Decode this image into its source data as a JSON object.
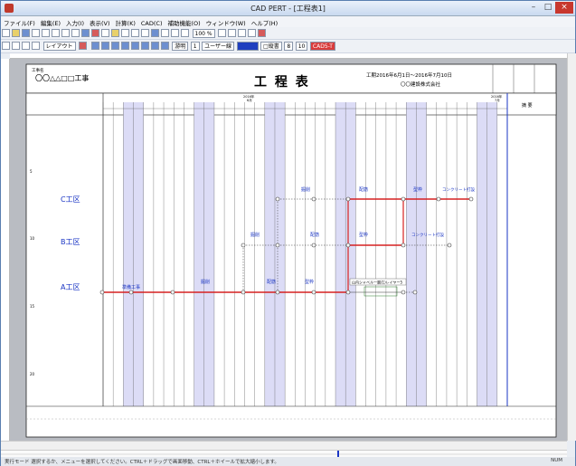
{
  "window": {
    "title": "CAD PERT - [工程表1]",
    "minimize": "–",
    "maximize": "□",
    "close": "×"
  },
  "menu": [
    "ファイル(F)",
    "編集(E)",
    "入力(I)",
    "表示(V)",
    "計算(K)",
    "CAD(C)",
    "補助機能(O)",
    "ウィンドウ(W)",
    "ヘルプ(H)"
  ],
  "toolbar": {
    "zoom": "100 %",
    "layout_label": "レイアウト",
    "font_label": "游明",
    "pen_label": "1",
    "layer_label": "ユーザー線",
    "grid_label": "□縦書",
    "size_a": "8",
    "size_b": "10",
    "mode_badge": "CAD5-T"
  },
  "sheet": {
    "company_small": "工事名",
    "project_name": "〇〇△△□□工事",
    "title": "工 程 表",
    "period": "工期2016年6月1日～2016年7月10日",
    "company": "〇〇建設株式会社",
    "year_month_left": "2016年",
    "month_left": "6月",
    "year_month_right": "2016年",
    "month_right": "7月",
    "remarks_header": "摘 要",
    "row_numbers": [
      "5",
      "10",
      "15",
      "20"
    ],
    "zones": [
      "C工区",
      "B工区",
      "A工区"
    ],
    "tasks": [
      "準備工事",
      "掘削",
      "配筋",
      "型枠",
      "コンクリート打設",
      "掘削",
      "配筋",
      "型枠",
      "コンクリート打設",
      "配筋",
      "型枠",
      "コンクリート打設",
      "鉄筋"
    ],
    "resource_note": "山内シャベル一層(1)レイヤー5"
  },
  "status": {
    "text": "実行モード  選択するか、メニューを選択してください。CTRL＋ドラッグで画面移動、CTRL＋ホイールで拡大縮小します。",
    "right": "NUM"
  }
}
